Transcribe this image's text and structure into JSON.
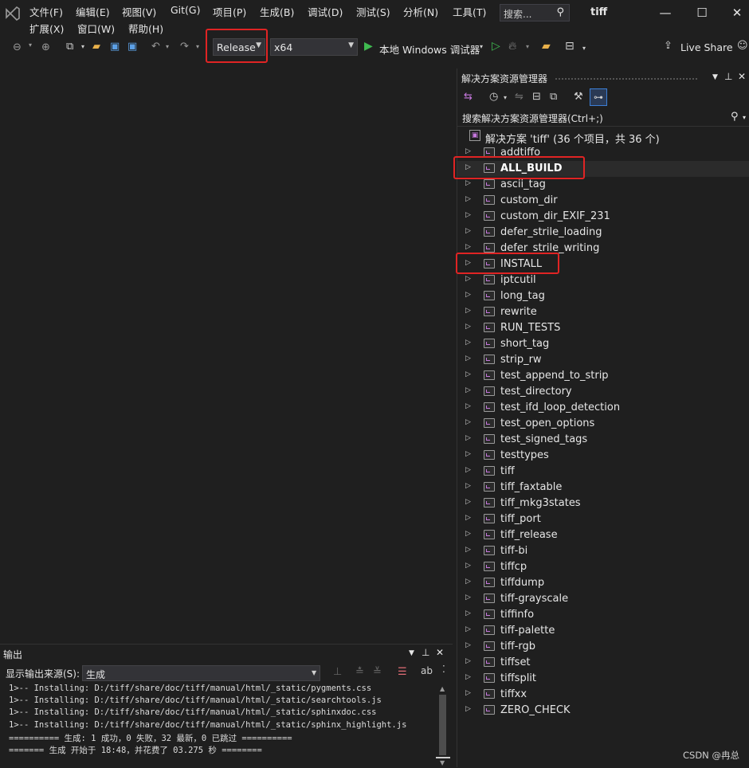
{
  "menu": {
    "row1": [
      "文件(F)",
      "编辑(E)",
      "视图(V)",
      "Git(G)",
      "项目(P)",
      "生成(B)",
      "调试(D)",
      "测试(S)",
      "分析(N)",
      "工具(T)"
    ],
    "row2": [
      "扩展(X)",
      "窗口(W)",
      "帮助(H)"
    ],
    "search_placeholder": "搜索...",
    "window_title": "tiff"
  },
  "toolbar": {
    "config": "Release",
    "platform": "x64",
    "run_target": "本地 Windows 调试器",
    "live_share": "Live Share"
  },
  "solution_explorer": {
    "title": "解决方案资源管理器",
    "search_placeholder": "搜索解决方案资源管理器(Ctrl+;)",
    "root": "解决方案 'tiff' (36 个项目，共 36 个)",
    "items": [
      "addtiffo",
      "ALL_BUILD",
      "ascii_tag",
      "custom_dir",
      "custom_dir_EXIF_231",
      "defer_strile_loading",
      "defer_strile_writing",
      "INSTALL",
      "iptcutil",
      "long_tag",
      "rewrite",
      "RUN_TESTS",
      "short_tag",
      "strip_rw",
      "test_append_to_strip",
      "test_directory",
      "test_ifd_loop_detection",
      "test_open_options",
      "test_signed_tags",
      "testtypes",
      "tiff",
      "tiff_faxtable",
      "tiff_mkg3states",
      "tiff_port",
      "tiff_release",
      "tiff-bi",
      "tiffcp",
      "tiffdump",
      "tiff-grayscale",
      "tiffinfo",
      "tiff-palette",
      "tiff-rgb",
      "tiffset",
      "tiffsplit",
      "tiffxx",
      "ZERO_CHECK"
    ],
    "bold_item": "ALL_BUILD"
  },
  "output": {
    "title": "输出",
    "source_label": "显示输出来源(S):",
    "source_value": "生成",
    "lines": [
      "1>-- Installing: D:/tiff/share/doc/tiff/manual/html/_static/pygments.css",
      "1>-- Installing: D:/tiff/share/doc/tiff/manual/html/_static/searchtools.js",
      "1>-- Installing: D:/tiff/share/doc/tiff/manual/html/_static/sphinxdoc.css",
      "1>-- Installing: D:/tiff/share/doc/tiff/manual/html/_static/sphinx_highlight.js",
      "========== 生成: 1 成功，0 失败，32 最新，0 已跳过 ==========",
      "======= 生成 开始于 18:48，并花费了 03.275 秒 ========"
    ]
  },
  "watermark": "CSDN @冉总",
  "colors": {
    "highlight": "#e02424",
    "background": "#1f1f1f",
    "run_green": "#3fba50",
    "icon_purple": "#c678dd"
  }
}
